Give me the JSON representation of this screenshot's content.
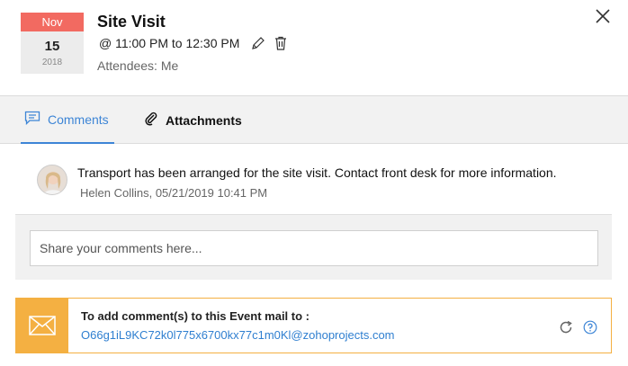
{
  "event": {
    "month": "Nov",
    "day": "15",
    "year": "2018",
    "title": "Site Visit",
    "time": "@ 11:00 PM to 12:30 PM",
    "attendees": "Attendees: Me"
  },
  "tabs": [
    {
      "label": "Comments",
      "icon": "comment-icon",
      "active": true
    },
    {
      "label": "Attachments",
      "icon": "paperclip-icon",
      "active": false
    }
  ],
  "comments": [
    {
      "text": "Transport has been arranged for the site visit. Contact front desk for more information.",
      "meta": "Helen Collins, 05/21/2019 10:41 PM"
    }
  ],
  "comment_input": {
    "placeholder": "Share your comments here..."
  },
  "mail": {
    "label": "To add comment(s) to this Event mail to :",
    "address": "O66g1iL9KC72k0l775x6700kx77c1m0Kl@zohoprojects.com",
    "icons": [
      "envelope-icon",
      "refresh-icon",
      "help-icon"
    ]
  },
  "colors": {
    "date_month_bg": "#f26a61",
    "accent_blue": "#3d85d6",
    "mail_orange": "#f4b042"
  }
}
